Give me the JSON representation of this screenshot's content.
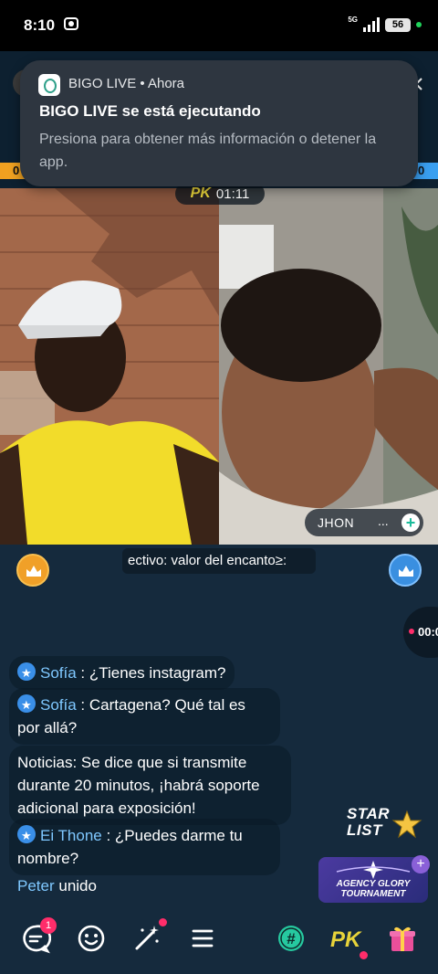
{
  "status_bar": {
    "time": "8:10",
    "network": "5G",
    "battery": "56"
  },
  "notification": {
    "app_name": "BIGO LIVE",
    "time": "Ahora",
    "title": "BIGO LIVE se está ejecutando",
    "body": "Presiona para obtener más información o detener la app."
  },
  "pk": {
    "left_score": "0",
    "right_score": "0",
    "badge": "PK",
    "timer": "01:11"
  },
  "streamer": {
    "name": "JHON",
    "dots": "..."
  },
  "marquee": "ectivo: valor del encanto≥:",
  "side_timer": "00:0",
  "chat": [
    {
      "user": "Sofía",
      "sep": " : ",
      "text": "¿Tienes instagram?"
    },
    {
      "user": "Sofía",
      "sep": " : ",
      "text": "Cartagena? Qué tal es por allá?"
    },
    {
      "user": "",
      "sep": "",
      "text": "Noticias: Se dice que si transmite durante 20 minutos, ¡habrá soporte adicional para exposición!"
    },
    {
      "user": "Ei Thone",
      "sep": " : ",
      "text": "¿Puedes darme tu nombre?"
    }
  ],
  "join": {
    "user": "Peter",
    "text": "unido"
  },
  "star_list": {
    "line1": "STAR",
    "line2": "LIST"
  },
  "agency": {
    "line1": "AGENCY GLORY",
    "line2": "TOURNAMENT"
  },
  "bottom": {
    "message_badge": "1",
    "pk_label": "PK",
    "hashtag": "#"
  },
  "colors": {
    "accent_blue": "#3a8fe8",
    "accent_pink": "#ff2d6a",
    "pk_gold": "#e7d33a"
  }
}
